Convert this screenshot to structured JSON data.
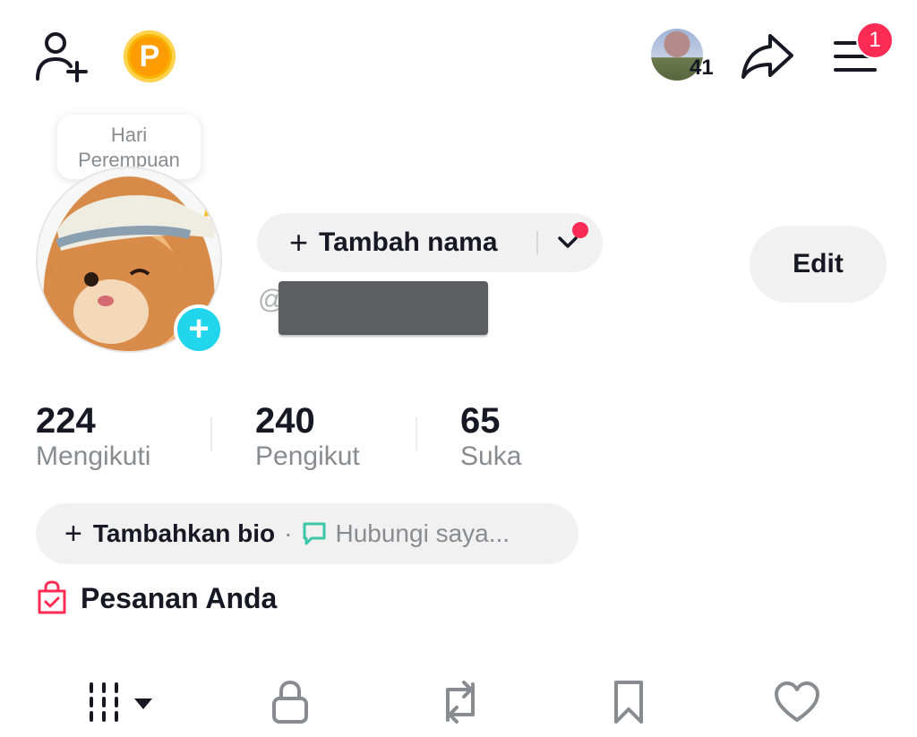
{
  "top_bar": {
    "coin_letter": "P",
    "viewer_count": "41",
    "notification_count": "1"
  },
  "profile": {
    "tooltip_line1": "Hari",
    "tooltip_line2": "Perempuan",
    "add_avatar": "+",
    "name_button": "Tambah nama",
    "name_plus": "+",
    "handle_prefix": "@",
    "edit_label": "Edit"
  },
  "stats": [
    {
      "value": "224",
      "label": "Mengikuti"
    },
    {
      "value": "240",
      "label": "Pengikut"
    },
    {
      "value": "65",
      "label": "Suka"
    }
  ],
  "bio": {
    "plus": "+",
    "add_label": "Tambahkan bio",
    "separator": "·",
    "contact_label": "Hubungi saya..."
  },
  "orders": {
    "label": "Pesanan Anda"
  },
  "colors": {
    "accent_red": "#fe2c55",
    "accent_cyan": "#20d5ec",
    "contact_green": "#3bc6a8",
    "coin_gold": "#ff9d00"
  },
  "icons": {
    "top_left": "add-friend-icon",
    "share": "share-icon",
    "menu": "menu-icon",
    "tabs": [
      "videos-grid-icon",
      "lock-icon",
      "repost-icon",
      "bookmark-icon",
      "heart-icon"
    ]
  }
}
